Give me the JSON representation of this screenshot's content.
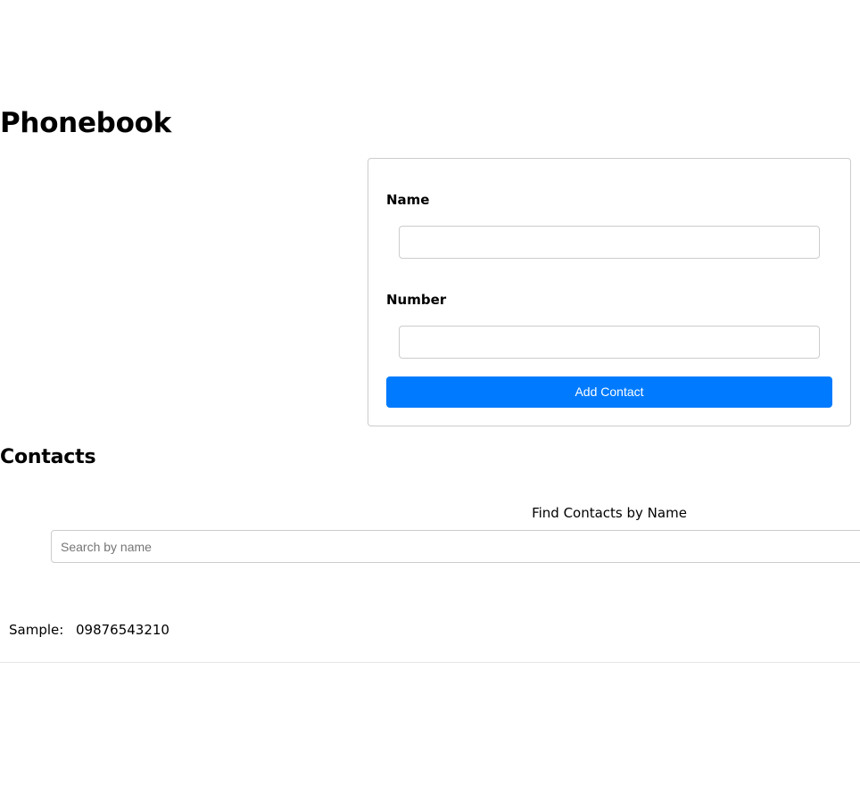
{
  "header": {
    "title": "Phonebook"
  },
  "form": {
    "name_label": "Name",
    "name_value": "",
    "name_placeholder": "",
    "number_label": "Number",
    "number_value": "",
    "number_placeholder": "",
    "submit_label": "Add Contact",
    "submit_color": "#007bff",
    "border_color": "#cccccc"
  },
  "contacts": {
    "title": "Contacts",
    "filter": {
      "label": "Find Contacts by Name",
      "placeholder": "Search by name",
      "value": ""
    },
    "items": [
      {
        "name": "Sample:",
        "number": "09876543210"
      }
    ]
  }
}
